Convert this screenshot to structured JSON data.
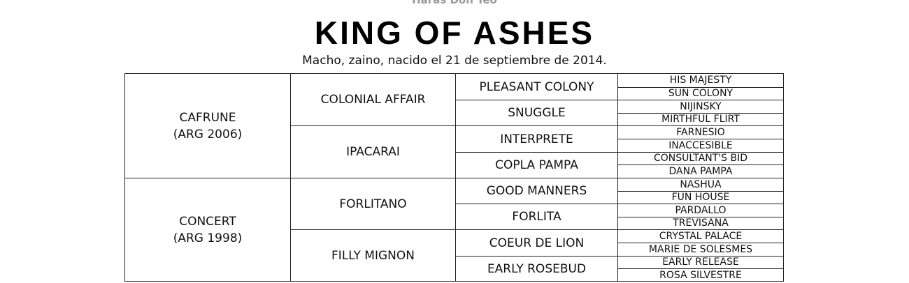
{
  "breeder": "Haras Don Teo",
  "horse_name": "KING OF ASHES",
  "description": "Macho, zaino, nacido el 21 de septiembre de 2014.",
  "pedigree": {
    "sire": {
      "name": "CAFRUNE",
      "detail": "(ARG 2006)"
    },
    "dam": {
      "name": "CONCERT",
      "detail": "(ARG 1998)"
    },
    "gen2": [
      "COLONIAL AFFAIR",
      "IPACARAI",
      "FORLITANO",
      "FILLY MIGNON"
    ],
    "gen3": [
      "PLEASANT COLONY",
      "SNUGGLE",
      "INTERPRETE",
      "COPLA PAMPA",
      "GOOD MANNERS",
      "FORLITA",
      "COEUR DE LION",
      "EARLY ROSEBUD"
    ],
    "gen4": [
      "HIS MAJESTY",
      "SUN COLONY",
      "NIJINSKY",
      "MIRTHFUL FLIRT",
      "FARNESIO",
      "INACCESIBLE",
      "CONSULTANT'S BID",
      "DANA PAMPA",
      "NASHUA",
      "FUN HOUSE",
      "PARDALLO",
      "TREVISANA",
      "CRYSTAL PALACE",
      "MARIE DE SOLESMES",
      "EARLY RELEASE",
      "ROSA SILVESTRE"
    ]
  }
}
